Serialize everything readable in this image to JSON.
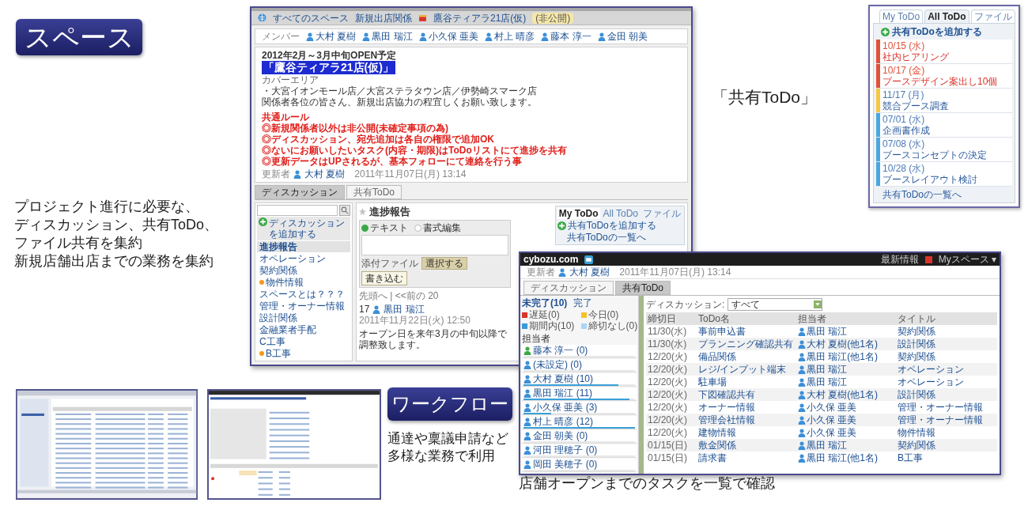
{
  "space_screen": {
    "breadcrumbs": [
      "すべてのスペース",
      "新規出店関係",
      "鷹谷ティアラ21店(仮)"
    ],
    "visibility": "(非公開)",
    "members_label": "メンバー",
    "members": [
      "大村 夏樹",
      "黒田 瑞江",
      "小久保 亜美",
      "村上 晴彦",
      "藤本 淳一",
      "金田 朝美"
    ],
    "notice": {
      "schedule": "2012年2月～3月中旬OPEN予定",
      "store_title": "「鷹谷ティアラ21店(仮)」",
      "area_label": "カバーエリア",
      "area": "・大宮イオンモール店／大宮ステラタウン店／伊勢崎スマーク店",
      "greeting": "関係者各位の皆さん、新規出店協力の程宜しくお願い致します。",
      "rules_heading": "共通ルール",
      "rules": [
        "◎新規関係者以外は非公開(未確定事項の為)",
        "◎ディスカッション、宛先追加は各自の権限で追加OK",
        "◎ないにお願いしたいタスク(内容・期限)はToDoリストにて進捗を共有",
        "◎更新データはUPされるが、基本フォローにて連絡を行う事"
      ],
      "updated_label": "更新者",
      "updater": "大村 夏樹",
      "updated_at": "2011年11月07日(月) 13:14"
    },
    "tabs": [
      {
        "label": "ディスカッション",
        "selected": true
      },
      {
        "label": "共有ToDo",
        "selected": false
      }
    ],
    "sidebar": {
      "add_button": "ディスカッションを追加する",
      "items": [
        {
          "label": "進捗報告",
          "selected": true,
          "flagged": false
        },
        {
          "label": "オペレーション",
          "selected": false,
          "flagged": false
        },
        {
          "label": "契約関係",
          "selected": false,
          "flagged": false
        },
        {
          "label": "物件情報",
          "selected": false,
          "flagged": true
        },
        {
          "label": "スペースとは？？？",
          "selected": false,
          "flagged": false
        },
        {
          "label": "管理・オーナー情報",
          "selected": false,
          "flagged": false
        },
        {
          "label": "設計関係",
          "selected": false,
          "flagged": false
        },
        {
          "label": "金融業者手配",
          "selected": false,
          "flagged": false
        },
        {
          "label": "C工事",
          "selected": false,
          "flagged": false
        },
        {
          "label": "B工事",
          "selected": false,
          "flagged": true
        }
      ]
    },
    "thread": {
      "title": "進捗報告",
      "formats": [
        {
          "label": "テキスト",
          "selected": true
        },
        {
          "label": "書式編集",
          "selected": false
        }
      ],
      "attach_label": "添付ファイル",
      "attach_button": "選択する",
      "submit_button": "書き込む",
      "pager": "先頭へ | <<前の 20",
      "post": {
        "number": "17",
        "author": "黒田 瑞江",
        "time": "2011年11月22日(火) 12:50",
        "text": "オープン日を来年3月の中旬以降で調整致します。"
      }
    },
    "todo_widget": {
      "tabs": [
        {
          "label": "My ToDo",
          "selected": true
        },
        {
          "label": "All ToDo",
          "selected": false
        },
        {
          "label": "ファイル",
          "selected": false
        }
      ],
      "add_link": "共有ToDoを追加する",
      "list_link": "共有ToDoの一覧へ"
    }
  },
  "space_badge": "スペース",
  "todo_caption": "「共有ToDo」",
  "todo_panel": {
    "tabs": [
      {
        "label": "My ToDo",
        "selected": false
      },
      {
        "label": "All ToDo",
        "selected": true
      },
      {
        "label": "ファイル",
        "selected": false
      }
    ],
    "add_link": "共有ToDoを追加する",
    "items": [
      {
        "date": "10/15 (水)",
        "title": "社内ヒアリング",
        "color": "#e0513a"
      },
      {
        "date": "10/17 (金)",
        "title": "ブースデザイン案出し10個",
        "color": "#e0513a"
      },
      {
        "date": "11/17 (月)",
        "title": "競合ブース調査",
        "color": "#f5c842"
      },
      {
        "date": "07/01 (水)",
        "title": "企画書作成",
        "color": "#4aa8e0"
      },
      {
        "date": "07/08 (水)",
        "title": "ブースコンセプトの決定",
        "color": "#4aa8e0"
      },
      {
        "date": "10/28 (水)",
        "title": "ブースレイアウト検討",
        "color": "#4aa8e0"
      }
    ],
    "list_link": "共有ToDoの一覧へ"
  },
  "list_screen": {
    "logo": "cybozu.com",
    "header_links": [
      "最新情報",
      "Myスペース ▾"
    ],
    "updated_label": "更新者",
    "updater": "大村 夏樹",
    "updated_at": "2011年11月07日(月) 13:14",
    "tabs": [
      {
        "label": "ディスカッション",
        "selected": false
      },
      {
        "label": "共有ToDo",
        "selected": true
      }
    ],
    "status_tabs": [
      {
        "label": "未完了(10)",
        "selected": true
      },
      {
        "label": "完了",
        "selected": false
      }
    ],
    "legend": [
      {
        "label": "遅延(0)",
        "color": "#d9342b"
      },
      {
        "label": "今日(0)",
        "color": "#f2c12e"
      },
      {
        "label": "期間内(10)",
        "color": "#3a9ad9"
      },
      {
        "label": "締切なし(0)",
        "color": "#a9d6f5"
      }
    ],
    "assignee_heading": "担当者",
    "assignees": [
      {
        "name": "藤本 淳一",
        "count": "(0)",
        "level": 0
      },
      {
        "name": "(未設定)",
        "count": "(0)",
        "level": 0
      },
      {
        "name": "大村 夏樹",
        "count": "(10)",
        "level": 0.85
      },
      {
        "name": "黒田 瑞江",
        "count": "(11)",
        "level": 0.95
      },
      {
        "name": "小久保 亜美",
        "count": "(3)",
        "level": 0.25
      },
      {
        "name": "村上 晴彦",
        "count": "(12)",
        "level": 1
      },
      {
        "name": "金田 朝美",
        "count": "(0)",
        "level": 0
      },
      {
        "name": "河田 理穂子",
        "count": "(0)",
        "level": 0
      },
      {
        "name": "岡田 美穂子",
        "count": "(0)",
        "level": 0
      }
    ],
    "filter_label": "ディスカッション:",
    "filter_value": "すべて",
    "table": {
      "columns": [
        "締切日",
        "ToDo名",
        "担当者",
        "タイトル"
      ],
      "rows": [
        [
          "11/30(水)",
          "事前申込書",
          "黒田 瑞江",
          "契約関係"
        ],
        [
          "11/30(水)",
          "プランニング確認共有",
          "大村 夏樹(他1名)",
          "設計関係"
        ],
        [
          "12/20(火)",
          "備品関係",
          "黒田 瑞江(他1名)",
          "契約関係"
        ],
        [
          "12/20(火)",
          "レジ/インプット端末",
          "黒田 瑞江",
          "オペレーション"
        ],
        [
          "12/20(火)",
          "駐車場",
          "黒田 瑞江",
          "オペレーション"
        ],
        [
          "12/20(火)",
          "下図確認共有",
          "大村 夏樹(他1名)",
          "設計関係"
        ],
        [
          "12/20(火)",
          "オーナー情報",
          "小久保 亜美",
          "管理・オーナー情報"
        ],
        [
          "12/20(火)",
          "管理会社情報",
          "小久保 亜美",
          "管理・オーナー情報"
        ],
        [
          "12/20(火)",
          "建物情報",
          "小久保 亜美",
          "物件情報"
        ],
        [
          "01/15(日)",
          "敷金関係",
          "黒田 瑞江",
          "契約関係"
        ],
        [
          "01/15(日)",
          "請求書",
          "黒田 瑞江(他1名)",
          "B工事"
        ]
      ]
    }
  },
  "left_caption": [
    "プロジェクト進行に必要な、",
    "ディスカッション、共有ToDo、",
    "ファイル共有を集約",
    "新規店舗出店までの業務を集約"
  ],
  "list_caption": "店舗オープンまでのタスクを一覧で確認",
  "workflow_badge": "ワークフロー",
  "workflow_caption": [
    "通達や稟議申請など",
    "多様な業務で利用"
  ]
}
